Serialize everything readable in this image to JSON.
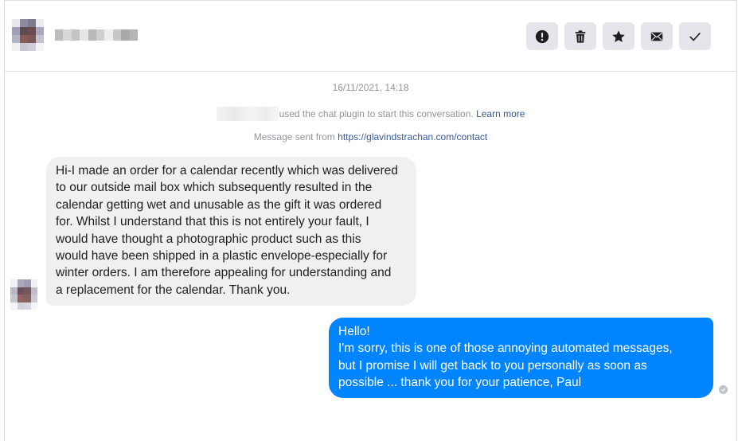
{
  "header": {
    "toolbar": [
      {
        "name": "report-button",
        "icon": "exclamation-circle-icon"
      },
      {
        "name": "delete-button",
        "icon": "trash-icon"
      },
      {
        "name": "star-button",
        "icon": "star-icon"
      },
      {
        "name": "mark-unread-button",
        "icon": "envelope-icon"
      },
      {
        "name": "mark-done-button",
        "icon": "checkmark-icon"
      }
    ]
  },
  "conversation": {
    "timestamp": "16/11/2021, 14:18",
    "plugin_text": "used the chat plugin to start this conversation.",
    "learn_more": "Learn more",
    "sent_from_label": "Message sent from",
    "sent_from_url": "https://glavindstrachan.com/contact",
    "incoming_message": "Hi-I made an order for a calendar recently which was delivered\nto our outside mail box which subsequently resulted in the\ncalendar getting wet and unusable as the gift it was ordered\nfor. Whilst I understand that this is not entirely your fault, I\nwould have thought a photographic product such as this\nwould have been shipped in a plastic envelope-especially for\nwinter orders. I am therefore appealing for understanding and\na replacement for the calendar. Thank you.",
    "outgoing_message": "Hello!\nI'm sorry, this is one of those annoying automated messages,\nbut I promise I will get back to you personally as soon as\npossible ... thank you for your patience, Paul"
  },
  "colors": {
    "outgoing_bubble": "#0084ff",
    "incoming_bubble": "#f0f0f0",
    "tool_button": "#e4e6eb",
    "link": "#385898",
    "meta_text": "#90949c"
  }
}
